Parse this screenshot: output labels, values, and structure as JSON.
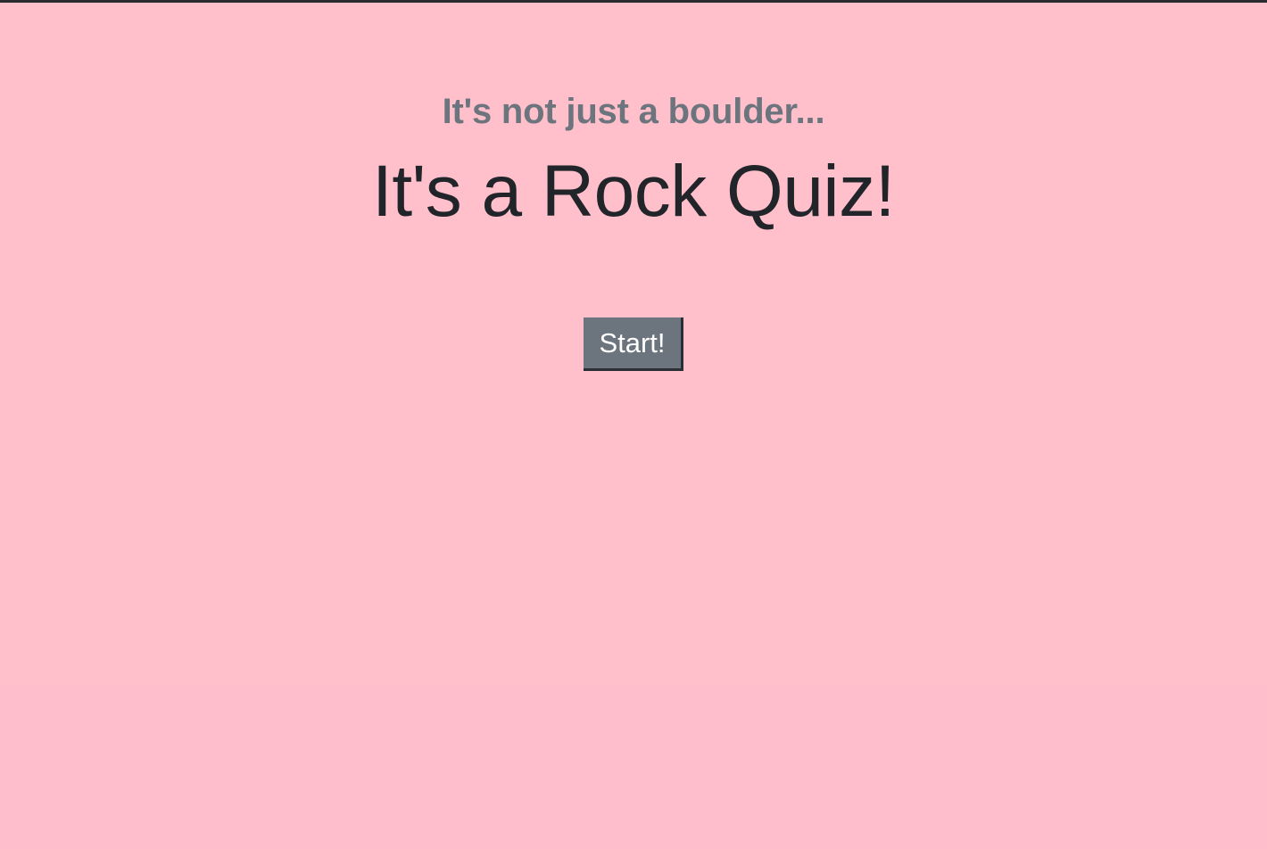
{
  "hero": {
    "subtitle": "It's not just a boulder...",
    "title": "It's a Rock Quiz!"
  },
  "actions": {
    "start_label": "Start!"
  },
  "colors": {
    "background": "#ffc0cb",
    "subtitle_text": "#6c757d",
    "title_text": "#212529",
    "button_background": "#6c757d",
    "button_text": "#ffffff"
  }
}
